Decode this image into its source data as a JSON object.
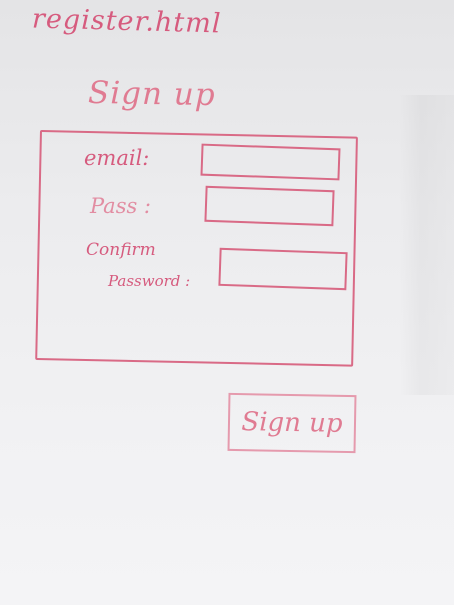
{
  "page": {
    "filename": "register.html",
    "title": "Sign up"
  },
  "form": {
    "email_label": "email:",
    "email_value": "",
    "password_label": "Pass :",
    "password_value": "",
    "confirm_label_line1": "Confirm",
    "confirm_label_line2": "Password :",
    "confirm_value": ""
  },
  "actions": {
    "signup_label": "Sign up"
  },
  "colors": {
    "ink": "#d96a86",
    "paper": "#ececee"
  }
}
